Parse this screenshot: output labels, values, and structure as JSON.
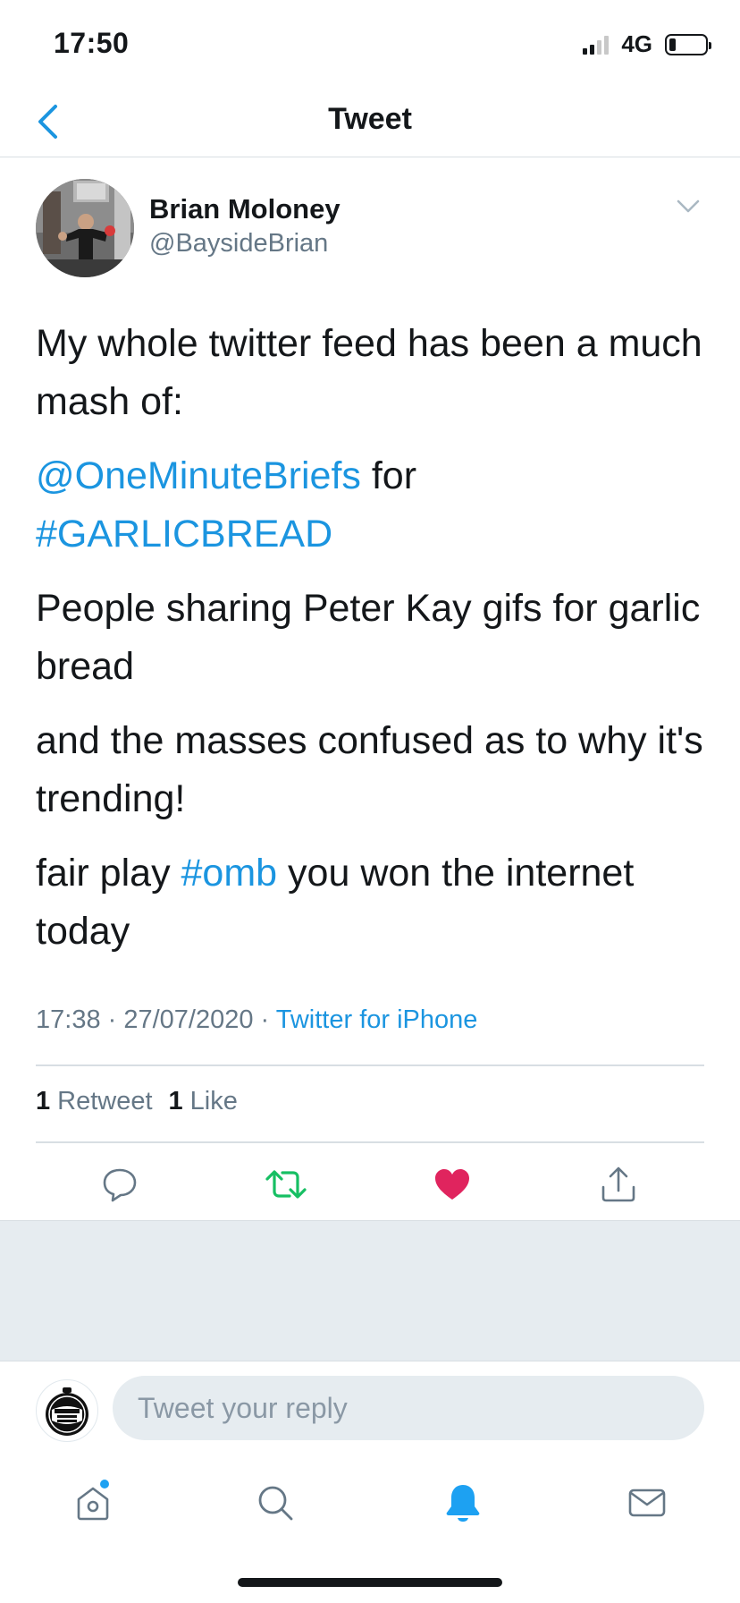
{
  "status_bar": {
    "time": "17:50",
    "network": "4G"
  },
  "header": {
    "title": "Tweet"
  },
  "tweet": {
    "author_name": "Brian Moloney",
    "author_handle": "@BaysideBrian",
    "paragraphs": {
      "p1": "My whole twitter feed has been a much mash of:",
      "p2_link1": "@OneMinuteBriefs",
      "p2_text": " for ",
      "p2_link2": "#GARLICBREAD",
      "p3": "People sharing Peter Kay gifs for garlic bread",
      "p4": "and the masses confused as to why it's trending!",
      "p5_pre": "fair play ",
      "p5_link": "#omb",
      "p5_post": " you won the internet today"
    },
    "timestamp": "17:38 · 27/07/2020 · ",
    "source": "Twitter for iPhone",
    "retweet_count": "1",
    "retweet_label": "Retweet",
    "like_count": "1",
    "like_label": "Like"
  },
  "reply": {
    "placeholder": "Tweet your reply"
  },
  "colors": {
    "accent": "#1b95e0",
    "retweet": "#17bf63",
    "like": "#e0245e",
    "muted": "#657786"
  },
  "icons": {
    "back": "chevron-left-icon",
    "caret": "chevron-down-icon",
    "reply": "comment-icon",
    "retweet": "retweet-icon",
    "like": "heart-icon",
    "share": "share-icon",
    "home": "home-icon",
    "search": "search-icon",
    "notifications": "bell-icon",
    "messages": "envelope-icon"
  }
}
